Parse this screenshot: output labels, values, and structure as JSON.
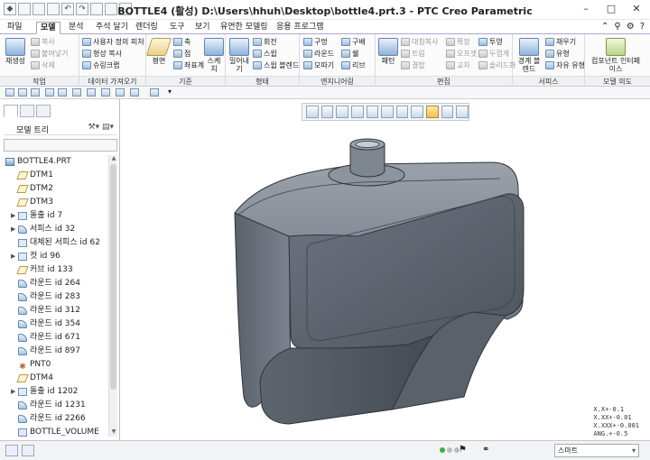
{
  "window": {
    "title": "BOTTLE4 (활성) D:\\Users\\hhuh\\Desktop\\bottle4.prt.3 - PTC Creo Parametric",
    "controls": [
      "–",
      "□",
      "✕"
    ]
  },
  "tabs": [
    {
      "label": "파일",
      "active": false
    },
    {
      "label": "모델",
      "active": true
    },
    {
      "label": "분석",
      "active": false
    },
    {
      "label": "주석 달기",
      "active": false
    },
    {
      "label": "렌더링",
      "active": false
    },
    {
      "label": "도구",
      "active": false
    },
    {
      "label": "보기",
      "active": false
    },
    {
      "label": "유연한 모델링",
      "active": false
    },
    {
      "label": "응용 프로그램",
      "active": false
    }
  ],
  "ribbon": {
    "groups": [
      {
        "label": "작업",
        "items": [
          "재생성",
          "복사",
          "붙여넣기",
          "삭제"
        ]
      },
      {
        "label": "데이터 가져오기",
        "items": [
          "사용자 정의 피처",
          "형상 복사",
          "슈링크랩"
        ]
      },
      {
        "label": "기준",
        "items": [
          "평면",
          "축",
          "점",
          "좌표계",
          "스케치"
        ]
      },
      {
        "label": "형태",
        "items": [
          "돌출",
          "회전",
          "스윕",
          "스윕 블렌드",
          "밀어내기"
        ]
      },
      {
        "label": "엔지니어링",
        "items": [
          "구멍",
          "라운드",
          "모따기",
          "구배",
          "쉘",
          "리브"
        ]
      },
      {
        "label": "편집",
        "items": [
          "패턴",
          "대칭복사",
          "트림",
          "결합",
          "확장",
          "오프셋",
          "교차",
          "투영",
          "두껍게",
          "솔리드화"
        ]
      },
      {
        "label": "서피스",
        "items": [
          "경계 블렌드",
          "채우기",
          "유형",
          "자유 유형"
        ]
      },
      {
        "label": "모델 의도",
        "items": [
          "컴포넌트 인터페이스"
        ]
      }
    ]
  },
  "left_panel": {
    "tree_label": "모델 트리",
    "items": [
      {
        "label": "BOTTLE4.PRT",
        "icon": "part-icon",
        "expandable": false
      },
      {
        "label": "DTM1",
        "icon": "datum-plane-icon",
        "expandable": false
      },
      {
        "label": "DTM2",
        "icon": "datum-plane-icon",
        "expandable": false
      },
      {
        "label": "DTM3",
        "icon": "datum-plane-icon",
        "expandable": false
      },
      {
        "label": "돌출 id 7",
        "icon": "extrude-icon",
        "expandable": true
      },
      {
        "label": "서피스 id 32",
        "icon": "surface-icon",
        "expandable": true
      },
      {
        "label": "대체된 서피스 id 62",
        "icon": "surface-icon",
        "expandable": false
      },
      {
        "label": "컷 id 96",
        "icon": "cut-icon",
        "expandable": true
      },
      {
        "label": "커브 id 133",
        "icon": "curve-icon",
        "expandable": false
      },
      {
        "label": "라운드 id 264",
        "icon": "round-icon",
        "expandable": false
      },
      {
        "label": "라운드 id 283",
        "icon": "round-icon",
        "expandable": false
      },
      {
        "label": "라운드 id 312",
        "icon": "round-icon",
        "expandable": false
      },
      {
        "label": "라운드 id 354",
        "icon": "round-icon",
        "expandable": false
      },
      {
        "label": "라운드 id 671",
        "icon": "round-icon",
        "expandable": false
      },
      {
        "label": "라운드 id 897",
        "icon": "round-icon",
        "expandable": false
      },
      {
        "label": "PNT0",
        "icon": "datum-point-icon",
        "expandable": false
      },
      {
        "label": "DTM4",
        "icon": "datum-plane-icon",
        "expandable": false
      },
      {
        "label": "돌출 id 1202",
        "icon": "extrude-icon",
        "expandable": true
      },
      {
        "label": "라운드 id 1231",
        "icon": "round-icon",
        "expandable": false
      },
      {
        "label": "라운드 id 2266",
        "icon": "round-icon",
        "expandable": false
      },
      {
        "label": "BOTTLE_VOLUME",
        "icon": "analysis-icon",
        "expandable": false
      }
    ]
  },
  "graphics": {
    "tolerance": [
      "X.X+-0.1",
      "X.XX+-0.01",
      "X.XXX+-0.001",
      "ANG.+-0.5"
    ]
  },
  "status": {
    "filter": "스마트"
  }
}
